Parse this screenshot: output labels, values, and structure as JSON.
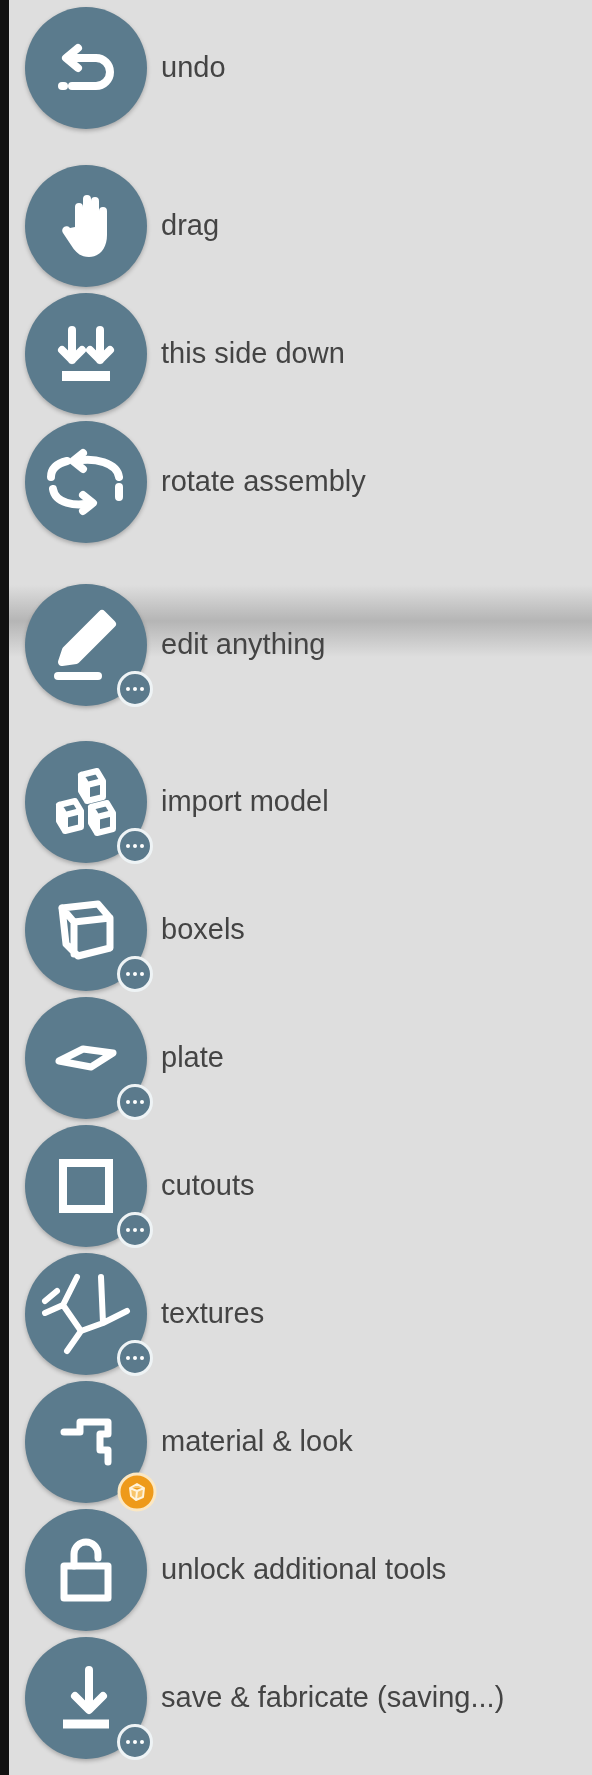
{
  "tools": [
    {
      "label": "undo",
      "kind": "plain"
    },
    {
      "label": "drag",
      "kind": "plain"
    },
    {
      "label": "this side down",
      "kind": "plain"
    },
    {
      "label": "rotate assembly",
      "kind": "plain"
    },
    {
      "label": "edit anything",
      "kind": "more"
    },
    {
      "label": "import model",
      "kind": "more"
    },
    {
      "label": "boxels",
      "kind": "more"
    },
    {
      "label": "plate",
      "kind": "more"
    },
    {
      "label": "cutouts",
      "kind": "more"
    },
    {
      "label": "textures",
      "kind": "more"
    },
    {
      "label": "material & look",
      "kind": "premium"
    },
    {
      "label": "unlock additional tools",
      "kind": "plain"
    },
    {
      "label": "save & fabricate (saving...)",
      "kind": "more"
    }
  ]
}
